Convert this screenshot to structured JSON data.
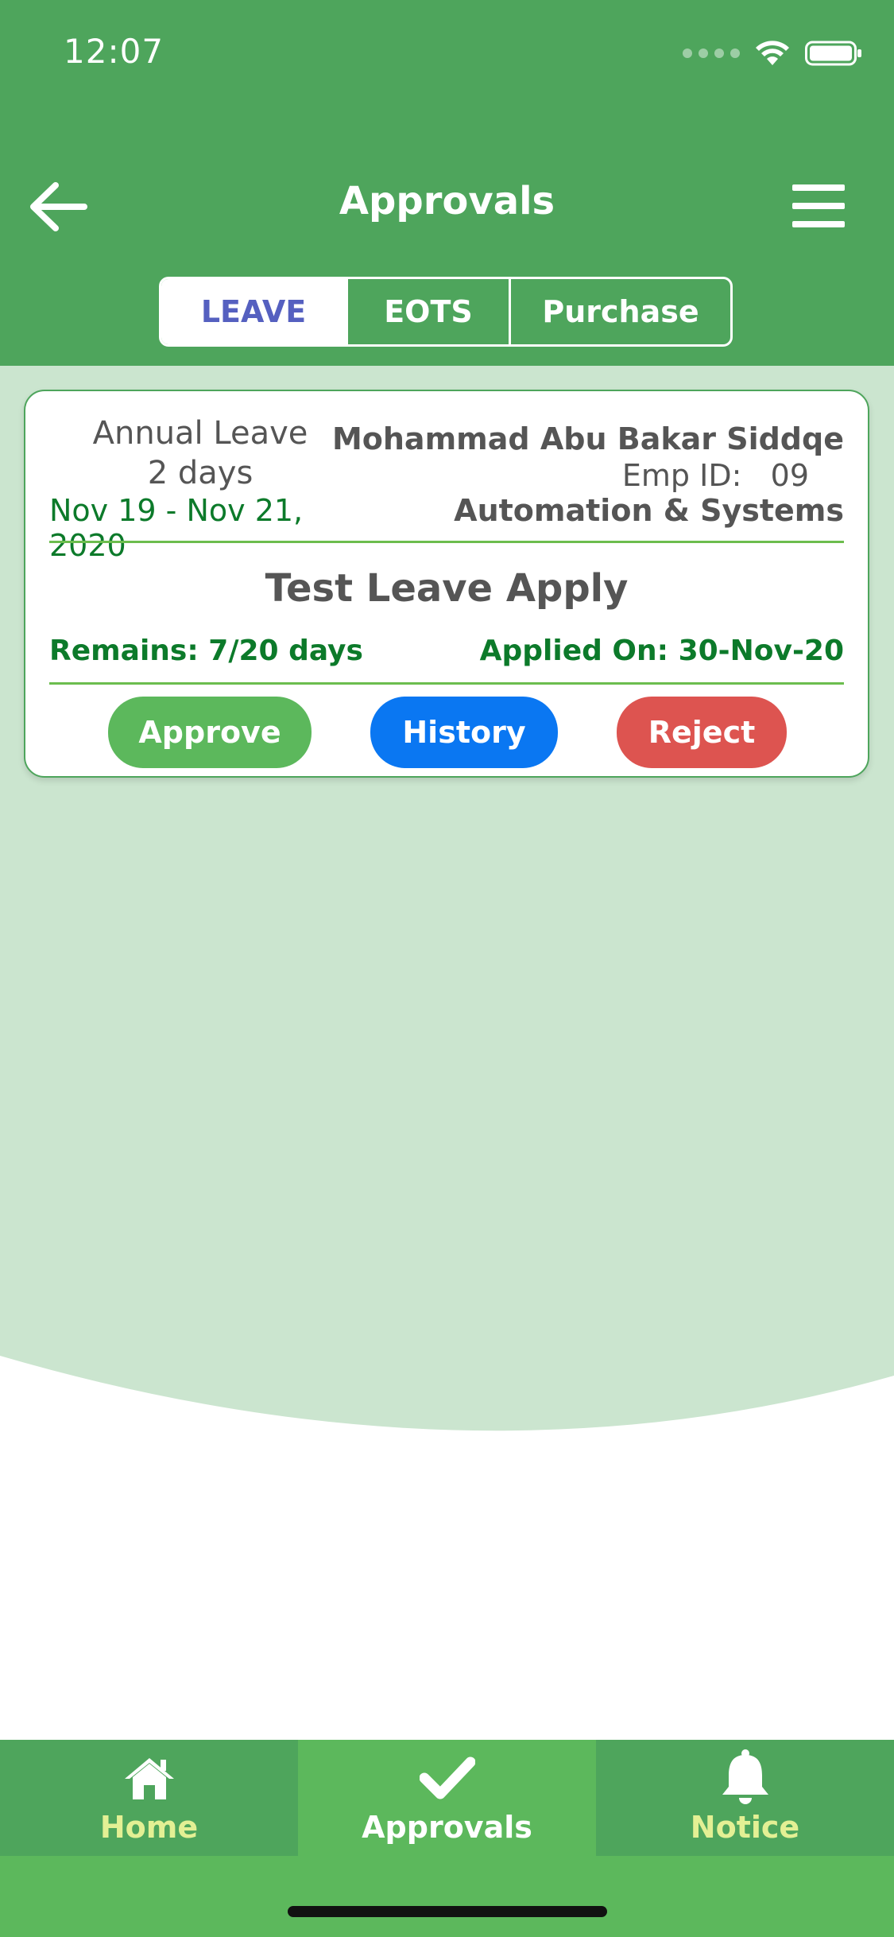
{
  "status_bar": {
    "time": "12:07"
  },
  "header": {
    "title": "Approvals"
  },
  "tabs": [
    {
      "label": "LEAVE",
      "active": true
    },
    {
      "label": "EOTS",
      "active": false
    },
    {
      "label": "Purchase",
      "active": false
    }
  ],
  "leave_card": {
    "leave_type": "Annual Leave",
    "days": "2 days",
    "date_range": "Nov 19 - Nov 21, 2020",
    "employee_name": "Mohammad Abu Bakar Siddqe",
    "employee_id": "Emp ID:   09",
    "department": "Automation & Systems",
    "subject": "Test Leave Apply",
    "remains": "Remains: 7/20 days",
    "applied_on": "Applied On: 30-Nov-20",
    "approve_label": "Approve",
    "history_label": "History",
    "reject_label": "Reject"
  },
  "bottom_nav": {
    "items": [
      {
        "label": "Home",
        "icon": "home-icon",
        "active": false
      },
      {
        "label": "Approvals",
        "icon": "check-icon",
        "active": true
      },
      {
        "label": "Notice",
        "icon": "bell-icon",
        "active": false
      }
    ]
  },
  "colors": {
    "header_green": "#4ea55c",
    "content_light_green": "#cbe5cf",
    "active_tab_text": "#5560c0",
    "approve": "#5cb85c",
    "history": "#0a77f2",
    "reject": "#dd5450",
    "nav_inactive_label": "#e3f094"
  }
}
